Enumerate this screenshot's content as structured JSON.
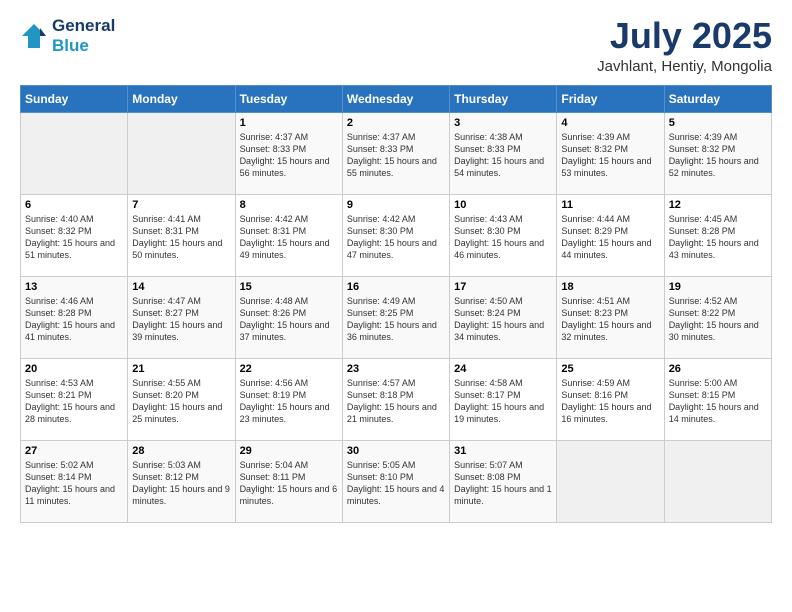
{
  "header": {
    "logo_line1": "General",
    "logo_line2": "Blue",
    "month": "July 2025",
    "location": "Javhlant, Hentiy, Mongolia"
  },
  "days_of_week": [
    "Sunday",
    "Monday",
    "Tuesday",
    "Wednesday",
    "Thursday",
    "Friday",
    "Saturday"
  ],
  "weeks": [
    [
      {
        "day": "",
        "empty": true
      },
      {
        "day": "",
        "empty": true
      },
      {
        "day": "1",
        "sunrise": "Sunrise: 4:37 AM",
        "sunset": "Sunset: 8:33 PM",
        "daylight": "Daylight: 15 hours and 56 minutes."
      },
      {
        "day": "2",
        "sunrise": "Sunrise: 4:37 AM",
        "sunset": "Sunset: 8:33 PM",
        "daylight": "Daylight: 15 hours and 55 minutes."
      },
      {
        "day": "3",
        "sunrise": "Sunrise: 4:38 AM",
        "sunset": "Sunset: 8:33 PM",
        "daylight": "Daylight: 15 hours and 54 minutes."
      },
      {
        "day": "4",
        "sunrise": "Sunrise: 4:39 AM",
        "sunset": "Sunset: 8:32 PM",
        "daylight": "Daylight: 15 hours and 53 minutes."
      },
      {
        "day": "5",
        "sunrise": "Sunrise: 4:39 AM",
        "sunset": "Sunset: 8:32 PM",
        "daylight": "Daylight: 15 hours and 52 minutes."
      }
    ],
    [
      {
        "day": "6",
        "sunrise": "Sunrise: 4:40 AM",
        "sunset": "Sunset: 8:32 PM",
        "daylight": "Daylight: 15 hours and 51 minutes."
      },
      {
        "day": "7",
        "sunrise": "Sunrise: 4:41 AM",
        "sunset": "Sunset: 8:31 PM",
        "daylight": "Daylight: 15 hours and 50 minutes."
      },
      {
        "day": "8",
        "sunrise": "Sunrise: 4:42 AM",
        "sunset": "Sunset: 8:31 PM",
        "daylight": "Daylight: 15 hours and 49 minutes."
      },
      {
        "day": "9",
        "sunrise": "Sunrise: 4:42 AM",
        "sunset": "Sunset: 8:30 PM",
        "daylight": "Daylight: 15 hours and 47 minutes."
      },
      {
        "day": "10",
        "sunrise": "Sunrise: 4:43 AM",
        "sunset": "Sunset: 8:30 PM",
        "daylight": "Daylight: 15 hours and 46 minutes."
      },
      {
        "day": "11",
        "sunrise": "Sunrise: 4:44 AM",
        "sunset": "Sunset: 8:29 PM",
        "daylight": "Daylight: 15 hours and 44 minutes."
      },
      {
        "day": "12",
        "sunrise": "Sunrise: 4:45 AM",
        "sunset": "Sunset: 8:28 PM",
        "daylight": "Daylight: 15 hours and 43 minutes."
      }
    ],
    [
      {
        "day": "13",
        "sunrise": "Sunrise: 4:46 AM",
        "sunset": "Sunset: 8:28 PM",
        "daylight": "Daylight: 15 hours and 41 minutes."
      },
      {
        "day": "14",
        "sunrise": "Sunrise: 4:47 AM",
        "sunset": "Sunset: 8:27 PM",
        "daylight": "Daylight: 15 hours and 39 minutes."
      },
      {
        "day": "15",
        "sunrise": "Sunrise: 4:48 AM",
        "sunset": "Sunset: 8:26 PM",
        "daylight": "Daylight: 15 hours and 37 minutes."
      },
      {
        "day": "16",
        "sunrise": "Sunrise: 4:49 AM",
        "sunset": "Sunset: 8:25 PM",
        "daylight": "Daylight: 15 hours and 36 minutes."
      },
      {
        "day": "17",
        "sunrise": "Sunrise: 4:50 AM",
        "sunset": "Sunset: 8:24 PM",
        "daylight": "Daylight: 15 hours and 34 minutes."
      },
      {
        "day": "18",
        "sunrise": "Sunrise: 4:51 AM",
        "sunset": "Sunset: 8:23 PM",
        "daylight": "Daylight: 15 hours and 32 minutes."
      },
      {
        "day": "19",
        "sunrise": "Sunrise: 4:52 AM",
        "sunset": "Sunset: 8:22 PM",
        "daylight": "Daylight: 15 hours and 30 minutes."
      }
    ],
    [
      {
        "day": "20",
        "sunrise": "Sunrise: 4:53 AM",
        "sunset": "Sunset: 8:21 PM",
        "daylight": "Daylight: 15 hours and 28 minutes."
      },
      {
        "day": "21",
        "sunrise": "Sunrise: 4:55 AM",
        "sunset": "Sunset: 8:20 PM",
        "daylight": "Daylight: 15 hours and 25 minutes."
      },
      {
        "day": "22",
        "sunrise": "Sunrise: 4:56 AM",
        "sunset": "Sunset: 8:19 PM",
        "daylight": "Daylight: 15 hours and 23 minutes."
      },
      {
        "day": "23",
        "sunrise": "Sunrise: 4:57 AM",
        "sunset": "Sunset: 8:18 PM",
        "daylight": "Daylight: 15 hours and 21 minutes."
      },
      {
        "day": "24",
        "sunrise": "Sunrise: 4:58 AM",
        "sunset": "Sunset: 8:17 PM",
        "daylight": "Daylight: 15 hours and 19 minutes."
      },
      {
        "day": "25",
        "sunrise": "Sunrise: 4:59 AM",
        "sunset": "Sunset: 8:16 PM",
        "daylight": "Daylight: 15 hours and 16 minutes."
      },
      {
        "day": "26",
        "sunrise": "Sunrise: 5:00 AM",
        "sunset": "Sunset: 8:15 PM",
        "daylight": "Daylight: 15 hours and 14 minutes."
      }
    ],
    [
      {
        "day": "27",
        "sunrise": "Sunrise: 5:02 AM",
        "sunset": "Sunset: 8:14 PM",
        "daylight": "Daylight: 15 hours and 11 minutes."
      },
      {
        "day": "28",
        "sunrise": "Sunrise: 5:03 AM",
        "sunset": "Sunset: 8:12 PM",
        "daylight": "Daylight: 15 hours and 9 minutes."
      },
      {
        "day": "29",
        "sunrise": "Sunrise: 5:04 AM",
        "sunset": "Sunset: 8:11 PM",
        "daylight": "Daylight: 15 hours and 6 minutes."
      },
      {
        "day": "30",
        "sunrise": "Sunrise: 5:05 AM",
        "sunset": "Sunset: 8:10 PM",
        "daylight": "Daylight: 15 hours and 4 minutes."
      },
      {
        "day": "31",
        "sunrise": "Sunrise: 5:07 AM",
        "sunset": "Sunset: 8:08 PM",
        "daylight": "Daylight: 15 hours and 1 minute."
      },
      {
        "day": "",
        "empty": true
      },
      {
        "day": "",
        "empty": true
      }
    ]
  ]
}
